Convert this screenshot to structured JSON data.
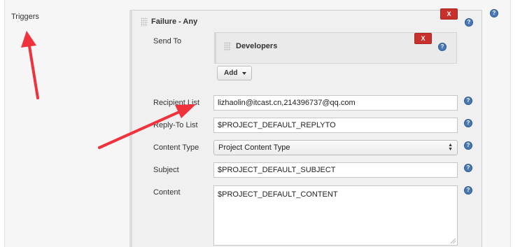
{
  "section": {
    "label": "Triggers"
  },
  "trigger": {
    "title": "Failure - Any",
    "delete_label": "X",
    "send_to": {
      "label": "Send To",
      "recipient_title": "Developers",
      "delete_label": "X",
      "add_label": "Add"
    },
    "recipient_list": {
      "label": "Recipient List",
      "value": "lizhaolin@itcast.cn,214396737@qq.com"
    },
    "reply_to_list": {
      "label": "Reply-To List",
      "value": "$PROJECT_DEFAULT_REPLYTO"
    },
    "content_type": {
      "label": "Content Type",
      "value": "Project Content Type"
    },
    "subject": {
      "label": "Subject",
      "value": "$PROJECT_DEFAULT_SUBJECT"
    },
    "content": {
      "label": "Content",
      "value": "$PROJECT_DEFAULT_CONTENT"
    }
  },
  "help": {
    "glyph": "?"
  },
  "colors": {
    "delete_red": "#c9302c",
    "help_blue": "#4a78b6",
    "arrow_red": "#f0323c"
  },
  "icons": [
    "help-icon",
    "drag-handle-icon",
    "close-icon",
    "caret-down-icon",
    "select-arrows-icon",
    "resize-handle-icon"
  ]
}
